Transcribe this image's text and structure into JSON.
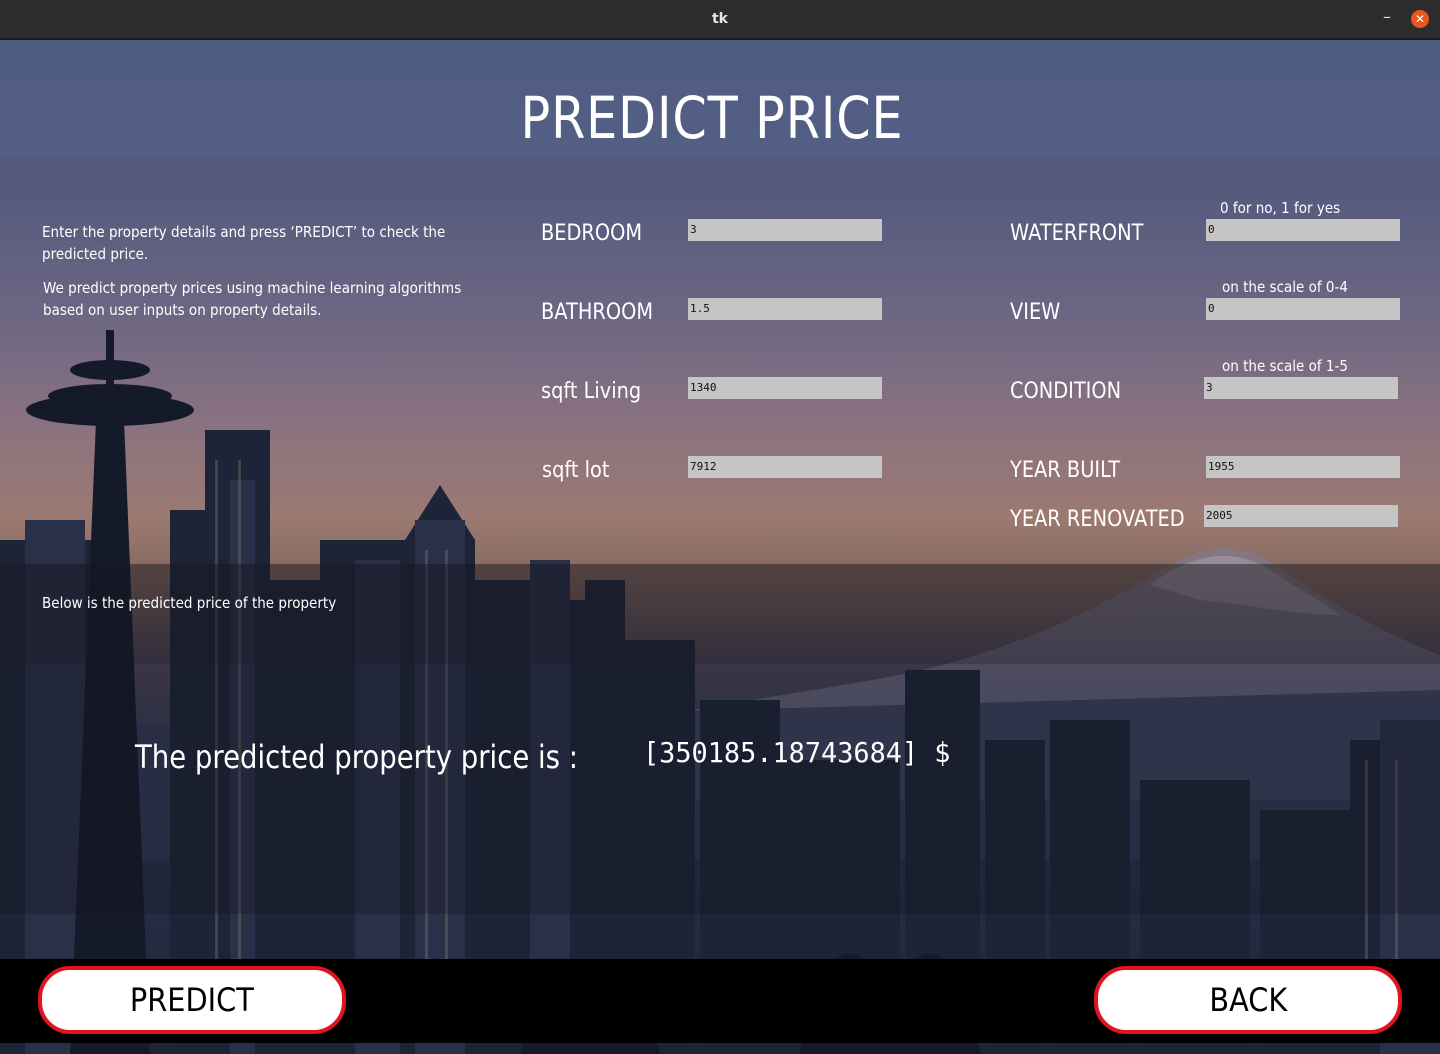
{
  "window": {
    "title": "tk",
    "minimize_glyph": "–",
    "close_glyph": "✕",
    "close_color": "#e95420"
  },
  "header": {
    "title": "PREDICT PRICE"
  },
  "intro": {
    "line1": "Enter the property details and press ‘PREDICT’ to check the predicted price.",
    "line2": "We predict property prices using machine learning algorithms based on user inputs on property details."
  },
  "form": {
    "bedroom": {
      "label": "BEDROOM",
      "value": "3"
    },
    "bathroom": {
      "label": "BATHROOM",
      "value": "1.5"
    },
    "sqft_living": {
      "label": "sqft Living",
      "value": "1340"
    },
    "sqft_lot": {
      "label": "sqft lot",
      "value": "7912"
    },
    "waterfront": {
      "label": "WATERFRONT",
      "hint": "0 for no, 1 for yes",
      "value": "0"
    },
    "view": {
      "label": "VIEW",
      "hint": "on the scale of 0-4",
      "value": "0"
    },
    "condition": {
      "label": "CONDITION",
      "hint": "on the scale of 1-5",
      "value": "3"
    },
    "year_built": {
      "label": "YEAR BUILT",
      "value": "1955"
    },
    "year_renovated": {
      "label": "YEAR RENOVATED",
      "value": "2005"
    }
  },
  "result": {
    "caption": "Below is the predicted price of the property",
    "label": "The predicted property price is :",
    "value": "[350185.18743684] $"
  },
  "buttons": {
    "predict": "PREDICT",
    "back": "BACK",
    "border_color": "#e0141e"
  }
}
